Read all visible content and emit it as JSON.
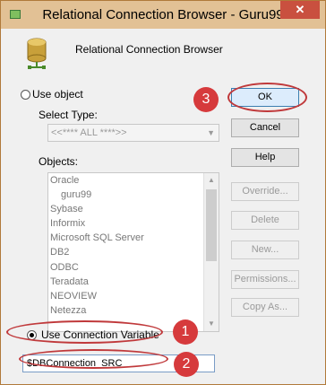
{
  "window": {
    "title": "Relational Connection Browser - Guru99",
    "close_label": "✕"
  },
  "header": {
    "text": "Relational Connection Browser",
    "icon": "database-icon"
  },
  "use_object": {
    "label": "Use object",
    "selected": false
  },
  "select_type": {
    "label": "Select Type:",
    "value": "<<**** ALL ****>>"
  },
  "objects": {
    "label": "Objects:",
    "items": [
      {
        "text": "Oracle",
        "indent": false
      },
      {
        "text": "guru99",
        "indent": true
      },
      {
        "text": "Sybase",
        "indent": false
      },
      {
        "text": "Informix",
        "indent": false
      },
      {
        "text": "Microsoft SQL Server",
        "indent": false
      },
      {
        "text": "DB2",
        "indent": false
      },
      {
        "text": "ODBC",
        "indent": false
      },
      {
        "text": "Teradata",
        "indent": false
      },
      {
        "text": "NEOVIEW",
        "indent": false
      },
      {
        "text": "Netezza",
        "indent": false
      }
    ]
  },
  "use_connection_variable": {
    "label": "Use Connection Variable",
    "selected": true
  },
  "connection_variable": {
    "value": "$DBConnection_SRC"
  },
  "buttons": {
    "ok": "OK",
    "cancel": "Cancel",
    "help": "Help",
    "override": "Override...",
    "delete": "Delete",
    "new": "New...",
    "permissions": "Permissions...",
    "copy_as": "Copy As..."
  },
  "annotations": {
    "marker_1": "1",
    "marker_2": "2",
    "marker_3": "3",
    "ring_color": "#c0393b",
    "marker_color": "#d63a3c"
  },
  "colors": {
    "title_bar": "#e2c195",
    "window_bg": "#f0f0f0",
    "default_button_bg": "#dcecfc",
    "default_button_border": "#3c7fb1"
  }
}
